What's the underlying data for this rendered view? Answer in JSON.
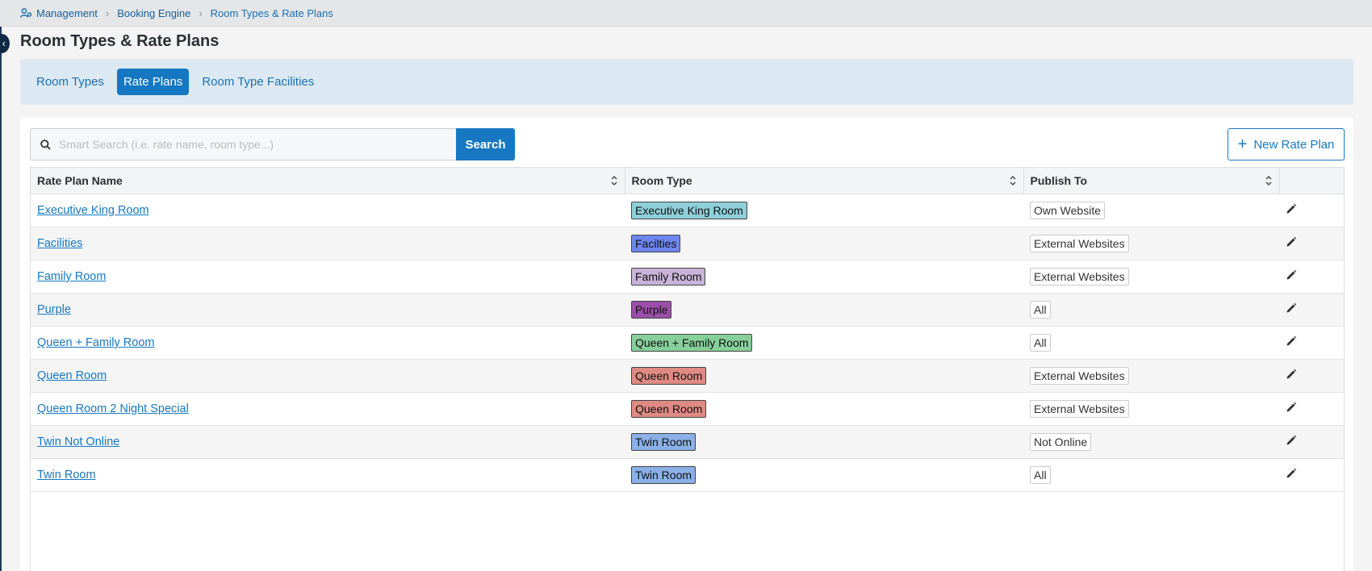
{
  "breadcrumb": {
    "items": [
      "Management",
      "Booking Engine",
      "Room Types & Rate Plans"
    ]
  },
  "page": {
    "title": "Room Types & Rate Plans"
  },
  "tabs": [
    {
      "label": "Room Types",
      "active": false
    },
    {
      "label": "Rate Plans",
      "active": true
    },
    {
      "label": "Room Type Facilities",
      "active": false
    }
  ],
  "search": {
    "placeholder": "Smart Search (i.e. rate name, room type...)",
    "value": "",
    "button_label": "Search",
    "icon": "search-icon"
  },
  "new_button": {
    "label": "New Rate Plan",
    "icon": "plus-icon"
  },
  "table": {
    "columns": [
      "Rate Plan Name",
      "Room Type",
      "Publish To",
      ""
    ],
    "rows": [
      {
        "name": "Executive King Room",
        "room_type": "Executive King Room",
        "room_color": "#8ecfd8",
        "publish": "Own Website"
      },
      {
        "name": "Facilities",
        "room_type": "Facilties",
        "room_color": "#6f86f0",
        "publish": "External Websites"
      },
      {
        "name": "Family Room",
        "room_type": "Family Room",
        "room_color": "#c9b3d9",
        "publish": "External Websites"
      },
      {
        "name": "Purple",
        "room_type": "Purple",
        "room_color": "#9b4fa8",
        "publish": "All"
      },
      {
        "name": "Queen + Family Room",
        "room_type": "Queen + Family Room",
        "room_color": "#86cf9a",
        "publish": "All"
      },
      {
        "name": "Queen Room",
        "room_type": "Queen Room",
        "room_color": "#df8a82",
        "publish": "External Websites"
      },
      {
        "name": "Queen Room 2 Night Special",
        "room_type": "Queen Room",
        "room_color": "#df8a82",
        "publish": "External Websites"
      },
      {
        "name": "Twin Not Online",
        "room_type": "Twin Room",
        "room_color": "#8ab0e6",
        "publish": "Not Online"
      },
      {
        "name": "Twin Room",
        "room_type": "Twin Room",
        "room_color": "#8ab0e6",
        "publish": "All"
      }
    ]
  }
}
